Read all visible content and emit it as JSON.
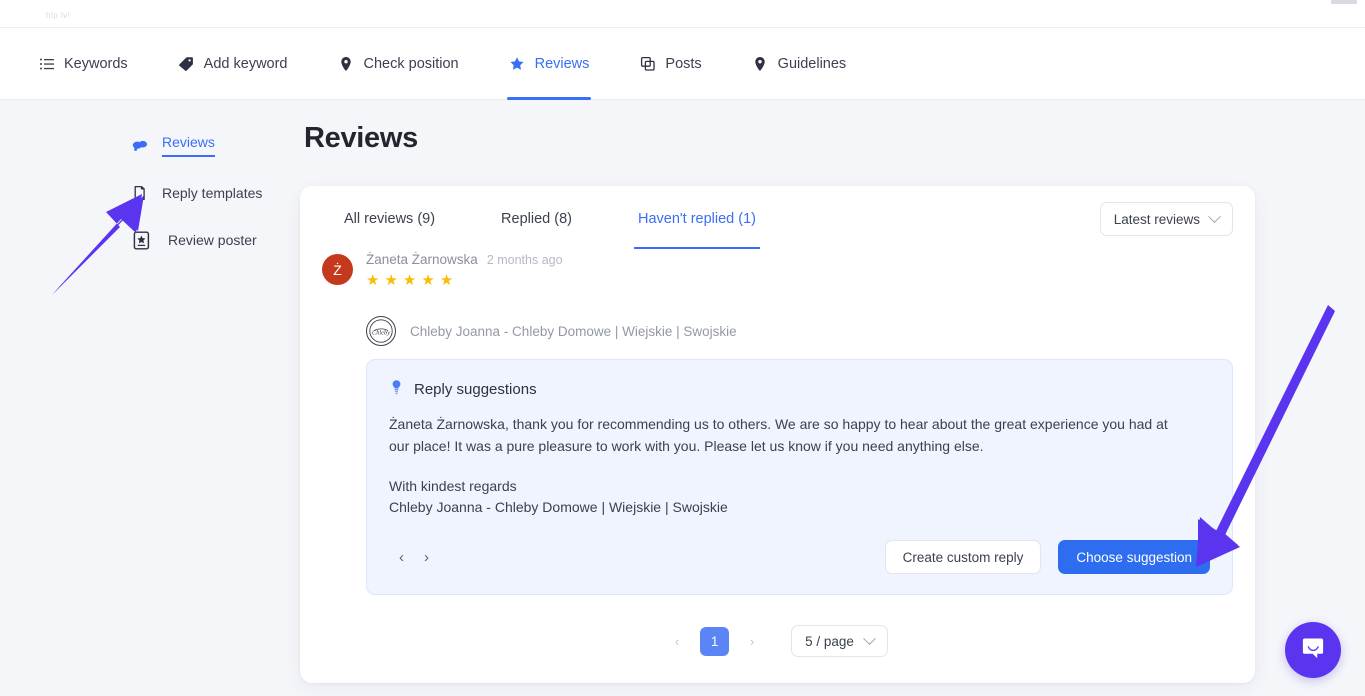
{
  "topbar": {
    "ghost_text": "hlp lv!"
  },
  "mainnav": {
    "items": [
      {
        "label": "Keywords",
        "icon": "list-icon",
        "active": false
      },
      {
        "label": "Add keyword",
        "icon": "tag-icon",
        "active": false
      },
      {
        "label": "Check position",
        "icon": "map-pin-icon",
        "active": false
      },
      {
        "label": "Reviews",
        "icon": "star-icon",
        "active": true
      },
      {
        "label": "Posts",
        "icon": "copy-icon",
        "active": false
      },
      {
        "label": "Guidelines",
        "icon": "map-pin-icon",
        "active": false
      }
    ]
  },
  "sidebar": {
    "items": [
      {
        "label": "Reviews",
        "icon": "reviews-icon",
        "active": true
      },
      {
        "label": "Reply templates",
        "icon": "template-icon",
        "active": false
      },
      {
        "label": "Review poster",
        "icon": "poster-icon",
        "active": false
      }
    ]
  },
  "page": {
    "title": "Reviews"
  },
  "tabs": [
    {
      "label": "All reviews (9)",
      "active": false
    },
    {
      "label": "Replied (8)",
      "active": false
    },
    {
      "label": "Haven't replied (1)",
      "active": true
    }
  ],
  "sort": {
    "label": "Latest reviews"
  },
  "review": {
    "avatar_initial": "Ż",
    "author": "Żaneta Żarnowska",
    "time": "2 months ago",
    "rating": 5,
    "stars": [
      "★",
      "★",
      "★",
      "★",
      "★"
    ],
    "business_name": "Chleby Joanna - Chleby Domowe | Wiejskie | Swojskie",
    "business_logo_text": "Chleby"
  },
  "suggestion": {
    "heading": "Reply suggestions",
    "icon": "lightbulb-icon",
    "body": "Żaneta Żarnowska, thank you for recommending us to others. We are so happy to hear about the great experience you had at our place! It was a pure pleasure to work with you. Please let us know if you need anything else.",
    "sign_off": "With kindest regards",
    "signature": "Chleby Joanna - Chleby Domowe | Wiejskie | Swojskie",
    "prev_arrow": "‹",
    "next_arrow": "›",
    "secondary_button": "Create custom reply",
    "primary_button": "Choose suggestion"
  },
  "pagination": {
    "prev": "‹",
    "next": "›",
    "current_page": "1",
    "page_size": "5 / page"
  },
  "chat": {
    "icon": "chat-bubble-icon"
  },
  "colors": {
    "accent_blue": "#3b6ef6",
    "primary_button": "#2f6df0",
    "star_gold": "#fbbc04",
    "avatar_red": "#c4391c",
    "annotation_purple": "#5b34ef",
    "page_background": "#f5f6fa",
    "suggestion_background": "#eff4fe"
  }
}
